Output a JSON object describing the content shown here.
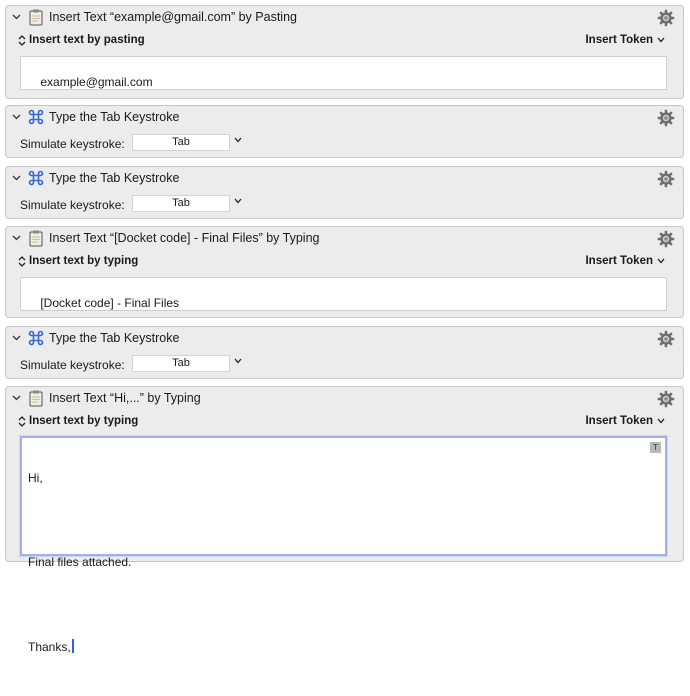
{
  "actions": [
    {
      "title": "Insert Text “example@gmail.com” by Pasting",
      "icon": "clipboard-icon",
      "mode": "Insert text by pasting",
      "token": "Insert Token",
      "text": "example@gmail.com"
    },
    {
      "title": "Type the Tab Keystroke",
      "icon": "command-key-icon",
      "label": "Simulate keystroke:",
      "key": "Tab"
    },
    {
      "title": "Type the Tab Keystroke",
      "icon": "command-key-icon",
      "label": "Simulate keystroke:",
      "key": "Tab"
    },
    {
      "title": "Insert Text “[Docket code] - Final Files” by Typing",
      "icon": "clipboard-icon",
      "mode": "Insert text by typing",
      "token": "Insert Token",
      "text": "[Docket code] - Final Files"
    },
    {
      "title": "Type the Tab Keystroke",
      "icon": "command-key-icon",
      "label": "Simulate keystroke:",
      "key": "Tab"
    },
    {
      "title": "Insert Text “Hi,...” by Typing",
      "icon": "clipboard-icon",
      "mode": "Insert text by typing",
      "token": "Insert Token",
      "text_lines": [
        "Hi,",
        "Final files attached.",
        "Thanks,"
      ],
      "badge": "T"
    }
  ],
  "colors": {
    "panel_bg": "#ececec",
    "focus_border": "#9fb4e4",
    "caret": "#2a62e0"
  }
}
